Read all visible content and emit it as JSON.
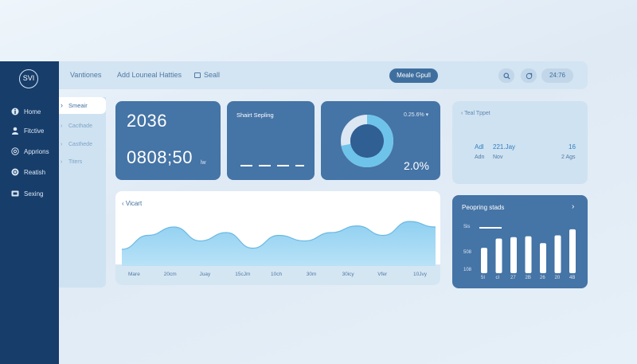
{
  "brand": {
    "logo": "SVI"
  },
  "sidebar": {
    "items": [
      {
        "label": "Home",
        "icon": "info-icon"
      },
      {
        "label": "Fitctive",
        "icon": "user-icon"
      },
      {
        "label": "Apprions",
        "icon": "globe-icon"
      },
      {
        "label": "Reatish",
        "icon": "refresh-icon"
      },
      {
        "label": "Sexing",
        "icon": "mail-icon"
      }
    ]
  },
  "header": {
    "links": [
      "Vantiones",
      "Add Louneal Hatties",
      "Seall"
    ],
    "button": "Meale Gpull",
    "time": "24:76"
  },
  "subnav": {
    "items": [
      "Smeair",
      "Cacthade",
      "Casthede",
      "Titers"
    ]
  },
  "cards": {
    "stat": {
      "value1": "2036",
      "value2": "0808;50",
      "unit": "lw"
    },
    "start": {
      "title": "Shairt Sepling"
    },
    "donut": {
      "header": "0.25.6%",
      "value": "2.0%",
      "fraction": 0.72
    },
    "top": {
      "title": "Teal Tppet",
      "row1": [
        "Adl",
        "221.Jay",
        "16"
      ],
      "row2": [
        "Adn",
        "Nov",
        "2 Ags"
      ]
    }
  },
  "chart": {
    "title": "Vicart",
    "x_labels": [
      "Mare",
      "20cm",
      "Juay",
      "15cJm",
      "10ch",
      "30m",
      "30icy",
      "Vfer",
      "10Jvy"
    ]
  },
  "bars": {
    "title": "Peopring stads",
    "y_labels": [
      "Sis",
      "508",
      "108"
    ],
    "x_labels": [
      "5I",
      "cI",
      "27",
      "2B",
      "26",
      "20",
      "4B"
    ],
    "legend_line": true
  },
  "chart_data": [
    {
      "type": "area",
      "title": "Vicart",
      "x": [
        "Mare",
        "20cm",
        "Juay",
        "15cJm",
        "10ch",
        "30m",
        "30icy",
        "Vfer",
        "10Jvy"
      ],
      "values": [
        0.3,
        0.55,
        0.7,
        0.45,
        0.6,
        0.32,
        0.55,
        0.45,
        0.6,
        0.72,
        0.55,
        0.8,
        0.7
      ]
    },
    {
      "type": "bar",
      "title": "Peopring stads",
      "categories": [
        "5I",
        "cI",
        "27",
        "2B",
        "26",
        "20",
        "4B"
      ],
      "values": [
        0.55,
        0.75,
        0.78,
        0.8,
        0.65,
        0.82,
        0.95
      ]
    }
  ],
  "colors": {
    "nav": "#173d6b",
    "card": "#4574a6",
    "accent": "#6ec3ea",
    "light": "#cfe2f1"
  }
}
